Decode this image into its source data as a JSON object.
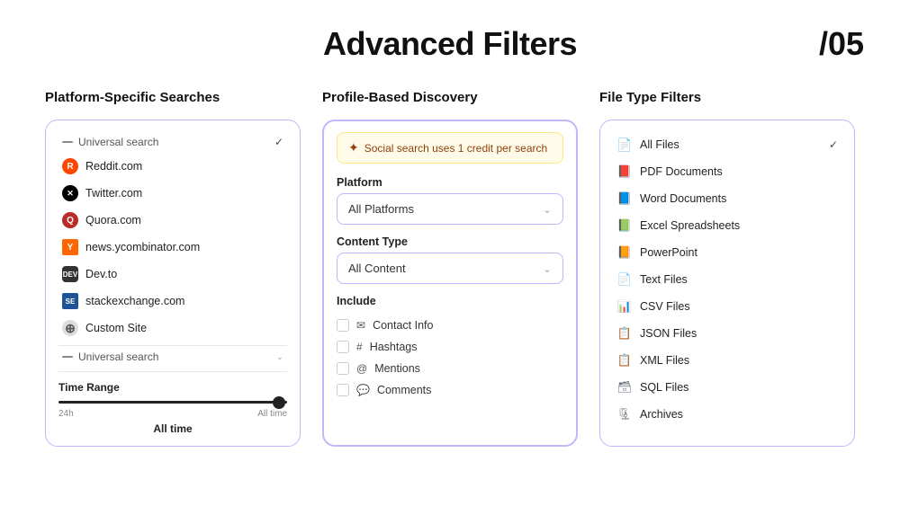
{
  "header": {
    "title": "Advanced Filters",
    "page_number": "/05"
  },
  "column1": {
    "title": "Platform-Specific Searches",
    "universal_label": "Universal search",
    "platforms": [
      {
        "name": "Reddit.com",
        "icon_class": "icon-reddit",
        "icon_text": "R"
      },
      {
        "name": "Twitter.com",
        "icon_class": "icon-twitter",
        "icon_text": "𝕏"
      },
      {
        "name": "Quora.com",
        "icon_class": "icon-quora",
        "icon_text": "Q"
      },
      {
        "name": "news.ycombinator.com",
        "icon_class": "icon-hn",
        "icon_text": "Y"
      },
      {
        "name": "Dev.to",
        "icon_class": "icon-devto",
        "icon_text": "D"
      },
      {
        "name": "stackexchange.com",
        "icon_class": "icon-se",
        "icon_text": "S"
      }
    ],
    "custom_site_label": "Custom Site",
    "universal_search_dropdown": "Universal search",
    "time_range_label": "Time Range",
    "time_min": "24h",
    "time_max": "All time",
    "all_time_label": "All time"
  },
  "column2": {
    "title": "Profile-Based Discovery",
    "notice_text": "Social search uses 1 credit per search",
    "platform_label": "Platform",
    "platform_value": "All Platforms",
    "content_type_label": "Content Type",
    "content_type_value": "All Content",
    "include_label": "Include",
    "include_items": [
      {
        "icon": "✉",
        "label": "Contact Info"
      },
      {
        "icon": "#",
        "label": "Hashtags"
      },
      {
        "icon": "@",
        "label": "Mentions"
      },
      {
        "icon": "💬",
        "label": "Comments"
      }
    ]
  },
  "column3": {
    "title": "File Type Filters",
    "files": [
      {
        "label": "All Files",
        "icon_class": "file-all",
        "icon": "📄",
        "active": true
      },
      {
        "label": "PDF Documents",
        "icon_class": "file-pdf",
        "icon": "📕"
      },
      {
        "label": "Word Documents",
        "icon_class": "file-word",
        "icon": "📘"
      },
      {
        "label": "Excel Spreadsheets",
        "icon_class": "file-excel",
        "icon": "📗"
      },
      {
        "label": "PowerPoint",
        "icon_class": "file-ppt",
        "icon": "📙"
      },
      {
        "label": "Text Files",
        "icon_class": "file-txt",
        "icon": "📄"
      },
      {
        "label": "CSV Files",
        "icon_class": "file-csv",
        "icon": "📊"
      },
      {
        "label": "JSON Files",
        "icon_class": "file-json",
        "icon": "📋"
      },
      {
        "label": "XML Files",
        "icon_class": "file-xml",
        "icon": "📋"
      },
      {
        "label": "SQL Files",
        "icon_class": "file-sql",
        "icon": "🗃"
      },
      {
        "label": "Archives",
        "icon_class": "file-archive",
        "icon": "🗜"
      }
    ]
  }
}
